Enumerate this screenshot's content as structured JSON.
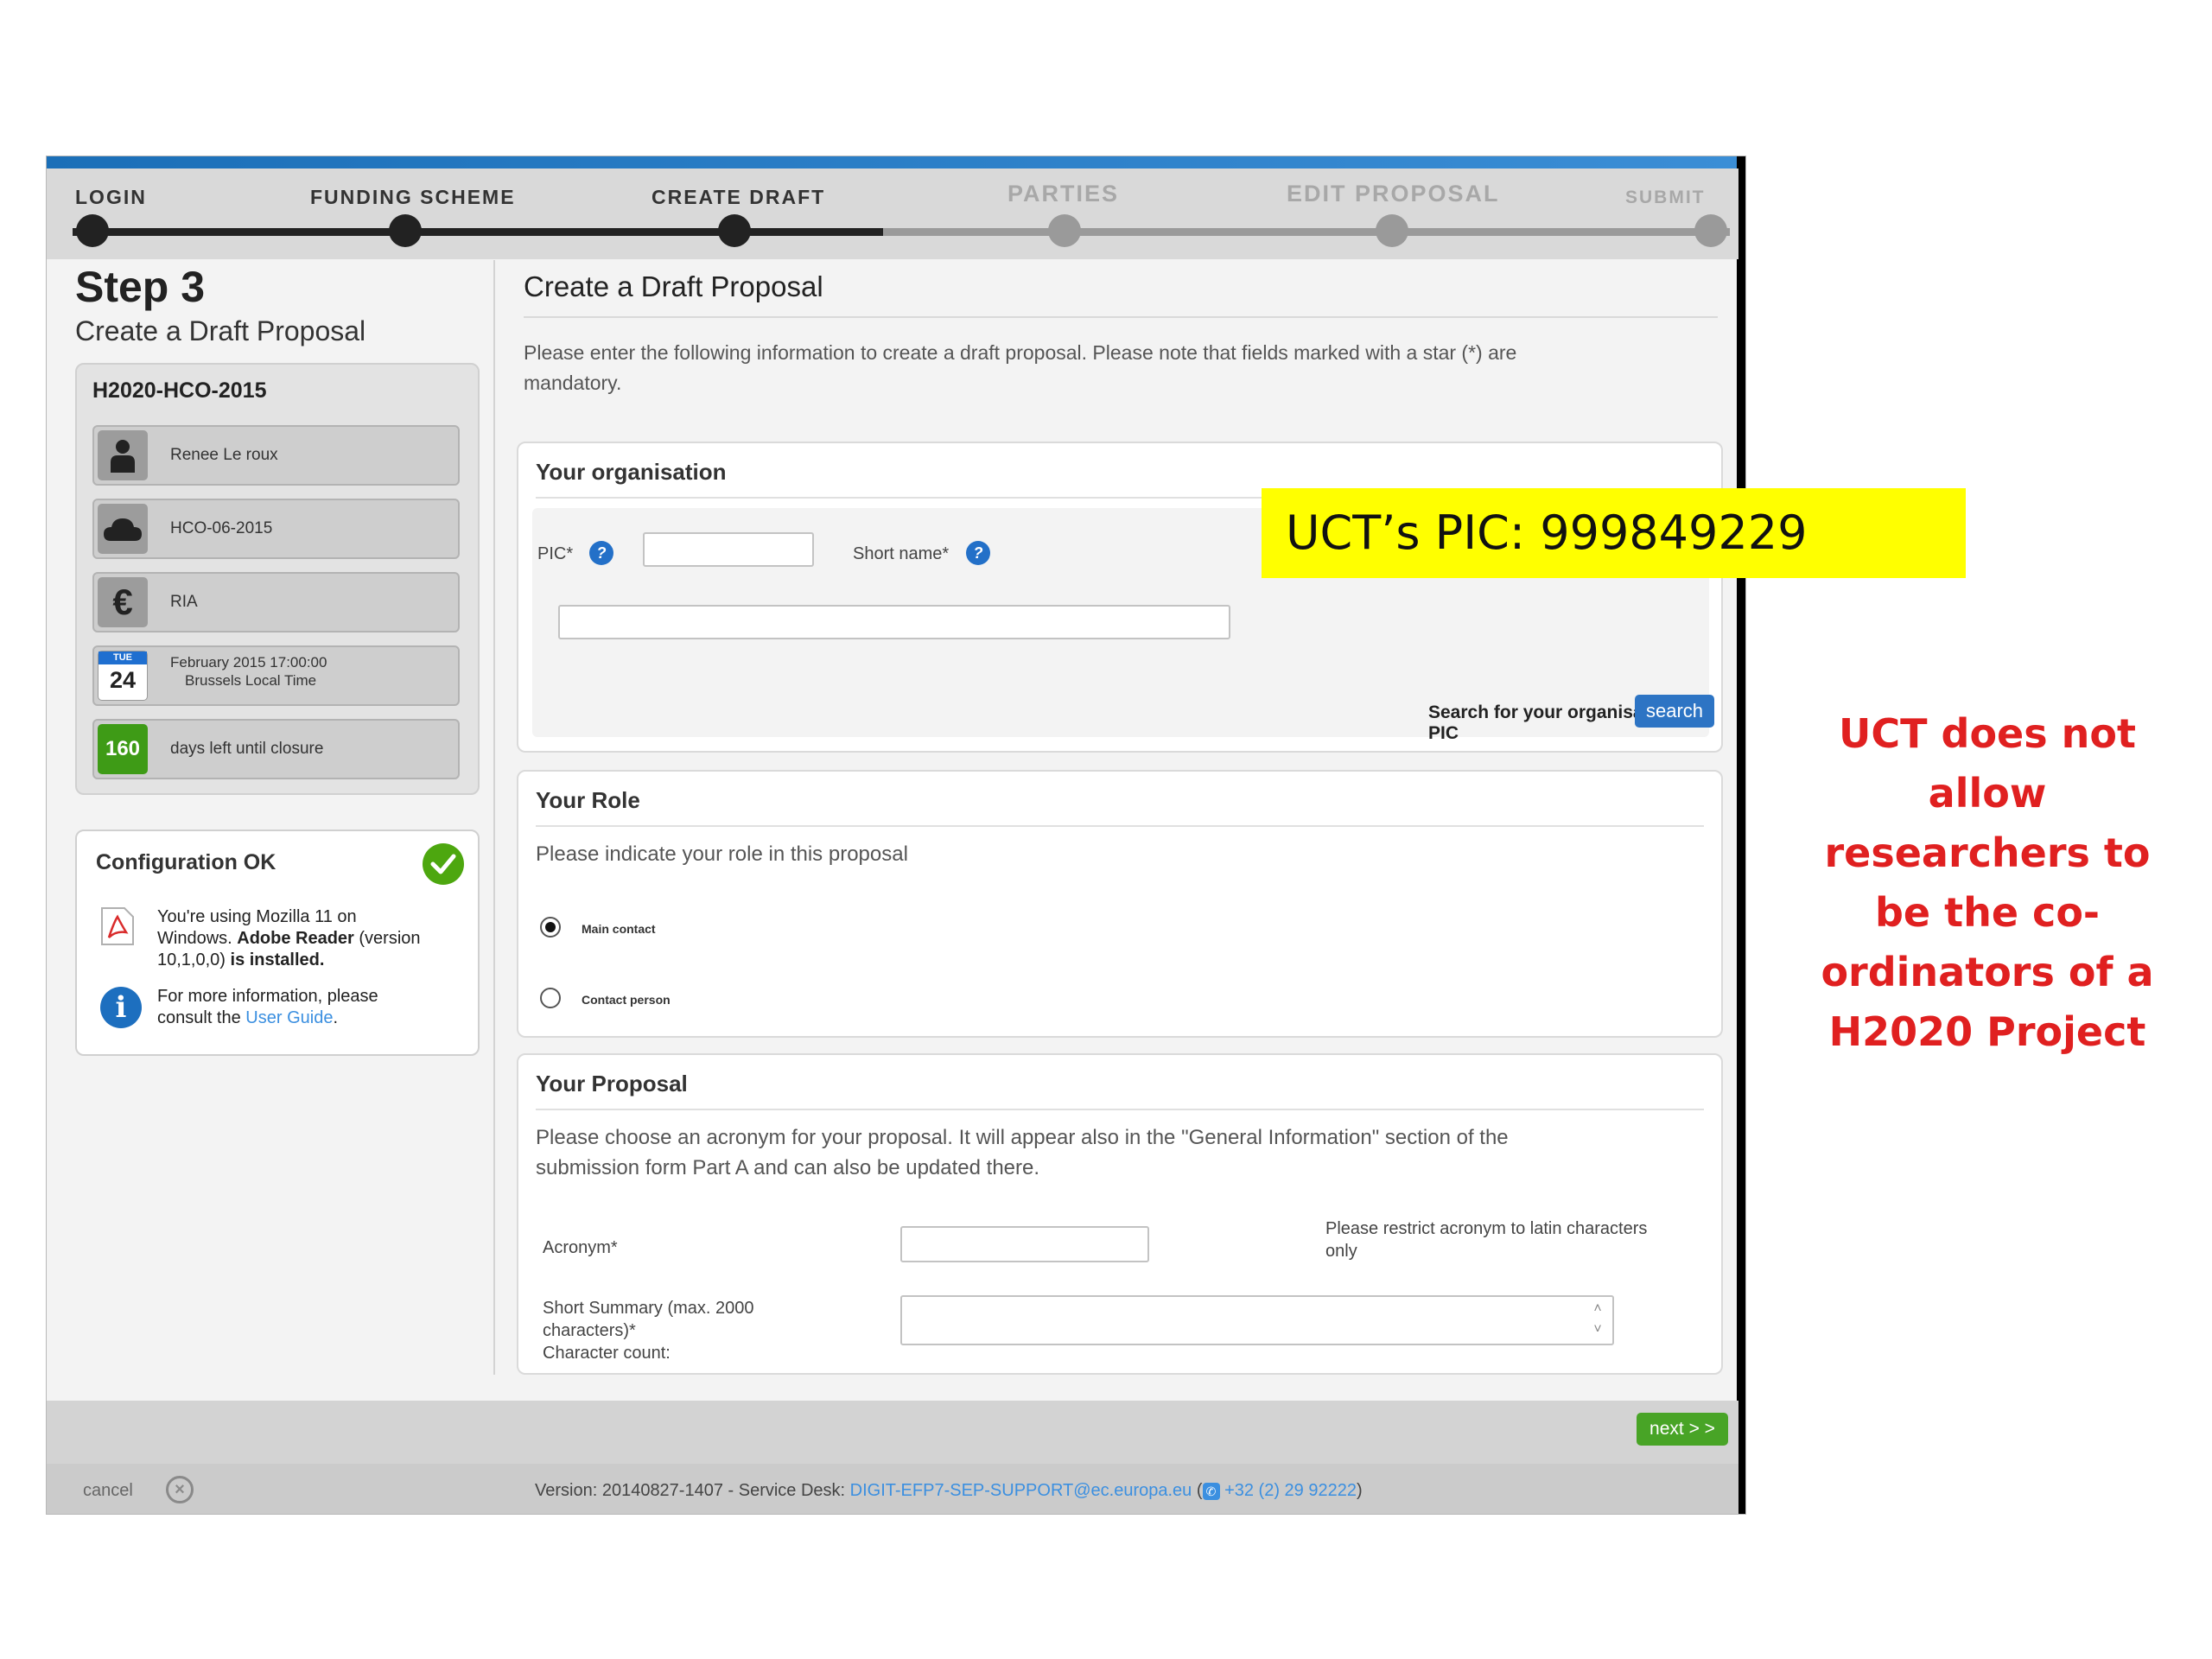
{
  "stepper": {
    "steps": [
      {
        "label": "LOGIN",
        "state": "done"
      },
      {
        "label": "FUNDING SCHEME",
        "state": "done"
      },
      {
        "label": "CREATE DRAFT",
        "state": "current"
      },
      {
        "label": "PARTIES",
        "state": "todo"
      },
      {
        "label": "EDIT PROPOSAL",
        "state": "todo"
      },
      {
        "label": "SUBMIT",
        "state": "todo"
      }
    ]
  },
  "sidebar": {
    "step_title": "Step 3",
    "step_subtitle": "Create a Draft Proposal",
    "call_id": "H2020-HCO-2015",
    "items": [
      {
        "icon": "person-icon",
        "text": "Renee Le roux"
      },
      {
        "icon": "cloud-icon",
        "text": "HCO-06-2015"
      },
      {
        "icon": "euro-icon",
        "text": "RIA"
      },
      {
        "icon": "calendar-icon",
        "cal_day": "TUE",
        "cal_num": "24",
        "text_line1": "February 2015 17:00:00",
        "text_line2": "Brussels Local Time"
      },
      {
        "icon": "countdown-badge",
        "badge": "160",
        "text": "days left until closure"
      }
    ],
    "config": {
      "title": "Configuration OK",
      "line1": "You're using Mozilla 11 on",
      "line2_pre": "Windows. ",
      "line2_bold": "Adobe Reader",
      "line2_post": " (version",
      "line3_pre": "10,1,0,0) ",
      "line3_bold": "is installed.",
      "info_line1": "For more information, please",
      "info_line2_pre": "consult the ",
      "info_link": "User Guide",
      "info_line2_post": "."
    }
  },
  "main": {
    "title": "Create a Draft Proposal",
    "intro_line1": "Please enter the following information to create a draft proposal. Please note that fields marked with a star (*) are",
    "intro_line2": "mandatory.",
    "organisation": {
      "title": "Your organisation",
      "pic_label": "PIC*",
      "pic_value": "",
      "short_name_label": "Short name*",
      "short_name_value": "",
      "search_label": "Search for your organisation PIC",
      "search_button": "search"
    },
    "role": {
      "title": "Your Role",
      "desc": "Please indicate your role in this proposal",
      "options": [
        {
          "label": "Main contact",
          "checked": true
        },
        {
          "label": "Contact person",
          "checked": false
        }
      ]
    },
    "proposal": {
      "title": "Your Proposal",
      "desc_line1": "Please choose an acronym for your proposal. It will appear also in the \"General Information\" section of the",
      "desc_line2": "submission form Part A and can also be updated there.",
      "acronym_label": "Acronym*",
      "acronym_value": "",
      "acronym_hint_line1": "Please restrict acronym to latin characters",
      "acronym_hint_line2": "only",
      "summary_label_line1": "Short Summary (max. 2000",
      "summary_label_line2": "characters)*",
      "summary_label_line3": "Character count:",
      "summary_value": ""
    }
  },
  "footer": {
    "next_button": "next > >",
    "cancel": "cancel",
    "version_text": "Version: 20140827-1407 - Service Desk: ",
    "email": "DIGIT-EFP7-SEP-SUPPORT@ec.europa.eu",
    "phone_open": " (",
    "phone": "+32 (2) 29 92222",
    "phone_close": ")"
  },
  "annotations": {
    "pic_callout": "UCT’s PIC: 999849229",
    "side_note": "UCT does not allow researchers to be the co-ordinators of a H2020 Project",
    "callout_color": "#ffff00",
    "note_color": "#e02020"
  }
}
